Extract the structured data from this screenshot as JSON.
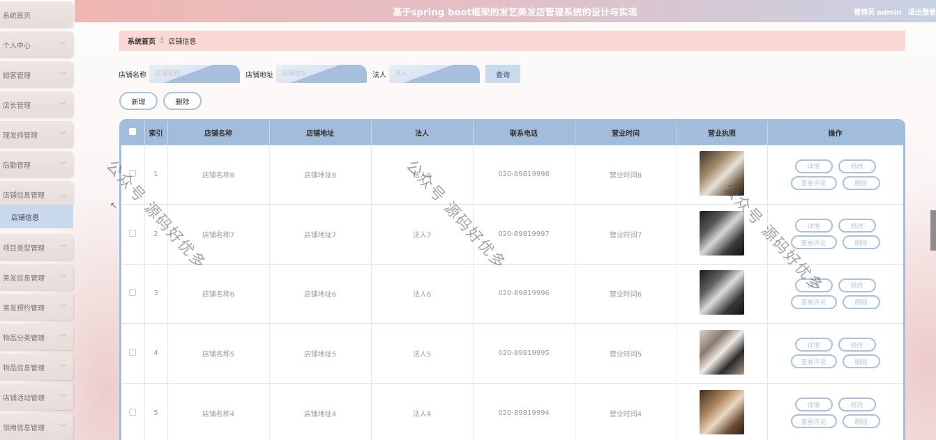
{
  "app": {
    "title": "基于spring boot框架的发艺美发店管理系统的设计与实现",
    "user_label": "管理员 admin",
    "logout_label": "退出登录"
  },
  "sidebar": {
    "items": [
      {
        "label": "系统首页",
        "chevron": false
      },
      {
        "label": "个人中心",
        "chevron": true
      },
      {
        "label": "顾客管理",
        "chevron": true
      },
      {
        "label": "店长管理",
        "chevron": true
      },
      {
        "label": "理发师管理",
        "chevron": true
      },
      {
        "label": "后勤管理",
        "chevron": true
      },
      {
        "label": "店铺信息管理",
        "chevron": true,
        "expanded": true
      },
      {
        "label": "项目类型管理",
        "chevron": true
      },
      {
        "label": "美发信息管理",
        "chevron": true
      },
      {
        "label": "美发预约管理",
        "chevron": true
      },
      {
        "label": "物品分类管理",
        "chevron": true
      },
      {
        "label": "物品信息管理",
        "chevron": true
      },
      {
        "label": "店铺活动管理",
        "chevron": true
      },
      {
        "label": "领用信息管理",
        "chevron": true
      }
    ],
    "sub_item": "店铺信息"
  },
  "breadcrumb": {
    "home": "系统首页",
    "current": "店铺信息"
  },
  "search": {
    "name_label": "店铺名称",
    "name_placeholder": "店铺名称",
    "address_label": "店铺地址",
    "address_placeholder": "店铺地址",
    "legal_label": "法人",
    "legal_placeholder": "法人",
    "query_label": "查询"
  },
  "actions": {
    "add_label": "新增",
    "delete_label": "删除"
  },
  "table": {
    "headers": [
      "索引",
      "店铺名称",
      "店铺地址",
      "法人",
      "联系电话",
      "营业时间",
      "营业执照",
      "操作"
    ],
    "op_labels": {
      "detail": "详情",
      "edit": "修改",
      "review": "查看评论",
      "delete": "删除"
    },
    "rows": [
      {
        "index": "1",
        "name": "店铺名称8",
        "address": "店铺地址8",
        "legal": "法人8",
        "phone": "020-89819998",
        "hours": "营业时间8"
      },
      {
        "index": "2",
        "name": "店铺名称7",
        "address": "店铺地址7",
        "legal": "法人7",
        "phone": "020-89819997",
        "hours": "营业时间7"
      },
      {
        "index": "3",
        "name": "店铺名称6",
        "address": "店铺地址6",
        "legal": "法人6",
        "phone": "020-89819996",
        "hours": "营业时间6"
      },
      {
        "index": "4",
        "name": "店铺名称5",
        "address": "店铺地址5",
        "legal": "法人5",
        "phone": "020-89819995",
        "hours": "营业时间5"
      },
      {
        "index": "5",
        "name": "店铺名称4",
        "address": "店铺地址4",
        "legal": "法人4",
        "phone": "020-89819994",
        "hours": "营业时间4"
      }
    ]
  },
  "watermark": "公众号 源码好优多",
  "colors": {
    "accent_blue": "#a2bddb",
    "breadcrumb_bg": "#fad8d4",
    "topbar_start": "#f0b7b2",
    "topbar_end": "#c8d2e4"
  }
}
